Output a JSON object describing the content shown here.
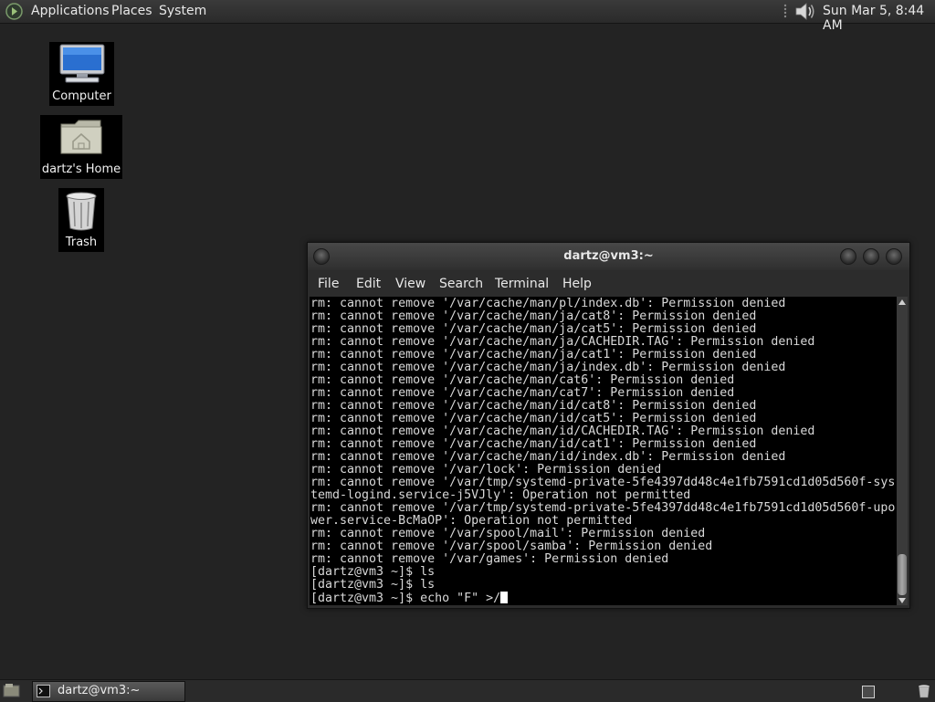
{
  "top_panel": {
    "menus": [
      "Applications",
      "Places",
      "System"
    ],
    "clock": "Sun Mar  5,  8:44 AM"
  },
  "desktop_icons": [
    {
      "label": "Computer"
    },
    {
      "label": "dartz's Home"
    },
    {
      "label": "Trash"
    }
  ],
  "terminal": {
    "title": "dartz@vm3:~",
    "menu": [
      "File",
      "Edit",
      "View",
      "Search",
      "Terminal",
      "Help"
    ],
    "output": "rm: cannot remove '/var/cache/man/pl/index.db': Permission denied\nrm: cannot remove '/var/cache/man/ja/cat8': Permission denied\nrm: cannot remove '/var/cache/man/ja/cat5': Permission denied\nrm: cannot remove '/var/cache/man/ja/CACHEDIR.TAG': Permission denied\nrm: cannot remove '/var/cache/man/ja/cat1': Permission denied\nrm: cannot remove '/var/cache/man/ja/index.db': Permission denied\nrm: cannot remove '/var/cache/man/cat6': Permission denied\nrm: cannot remove '/var/cache/man/cat7': Permission denied\nrm: cannot remove '/var/cache/man/id/cat8': Permission denied\nrm: cannot remove '/var/cache/man/id/cat5': Permission denied\nrm: cannot remove '/var/cache/man/id/CACHEDIR.TAG': Permission denied\nrm: cannot remove '/var/cache/man/id/cat1': Permission denied\nrm: cannot remove '/var/cache/man/id/index.db': Permission denied\nrm: cannot remove '/var/lock': Permission denied\nrm: cannot remove '/var/tmp/systemd-private-5fe4397dd48c4e1fb7591cd1d05d560f-sys\ntemd-logind.service-j5VJly': Operation not permitted\nrm: cannot remove '/var/tmp/systemd-private-5fe4397dd48c4e1fb7591cd1d05d560f-upo\nwer.service-BcMaOP': Operation not permitted\nrm: cannot remove '/var/spool/mail': Permission denied\nrm: cannot remove '/var/spool/samba': Permission denied\nrm: cannot remove '/var/games': Permission denied\n[dartz@vm3 ~]$ ls\n[dartz@vm3 ~]$ ls\n",
    "prompt_line": "[dartz@vm3 ~]$ echo \"F\" >/"
  },
  "taskbar": {
    "window_label": "dartz@vm3:~"
  },
  "icons": {
    "panel_logo": "gnome-foot-icon",
    "volume": "speaker-icon",
    "show_desktop": "show-desktop-icon",
    "terminal": "terminal-icon",
    "trash_applet": "trash-icon"
  }
}
